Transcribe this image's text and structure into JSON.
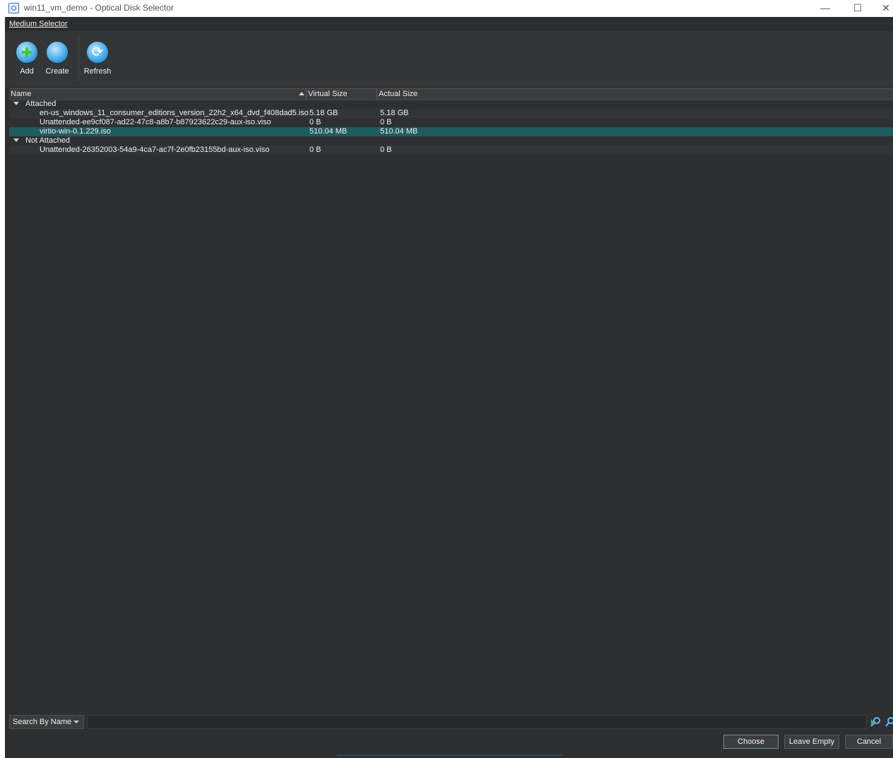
{
  "window": {
    "title": "win11_vm_demo - Optical Disk Selector",
    "minimize_glyph": "—",
    "maximize_glyph": "☐",
    "close_glyph": "✕"
  },
  "menu": {
    "medium_selector": "Medium Selector"
  },
  "toolbar": {
    "add_label": "Add",
    "create_label": "Create",
    "refresh_label": "Refresh",
    "refresh_glyph": "⟳"
  },
  "tree": {
    "columns": [
      "Name",
      "Virtual Size",
      "Actual Size"
    ],
    "groups": [
      {
        "label": "Attached",
        "items": [
          {
            "name": "en-us_windows_11_consumer_editions_version_22h2_x64_dvd_f408dad5.iso",
            "virtual_size": "5.18 GB",
            "actual_size": "5.18 GB"
          },
          {
            "name": "Unattended-ee9cf087-ad22-47c8-a8b7-b87923622c29-aux-iso.viso",
            "virtual_size": "0 B",
            "actual_size": "0 B"
          },
          {
            "name": "virtio-win-0.1.229.iso",
            "virtual_size": "510.04 MB",
            "actual_size": "510.04 MB",
            "selected": true
          }
        ]
      },
      {
        "label": "Not Attached",
        "items": [
          {
            "name": "Unattended-26352003-54a9-4ca7-ac7f-2e0fb23155bd-aux-iso.viso",
            "virtual_size": "0 B",
            "actual_size": "0 B"
          }
        ]
      }
    ]
  },
  "search": {
    "mode": "Search By Name",
    "value": ""
  },
  "buttons": {
    "choose": "Choose",
    "leave_empty": "Leave Empty",
    "cancel": "Cancel"
  },
  "colors": {
    "background": "#2d2f31",
    "selection": "#205b5e",
    "accent_icon": "#3fa6e6"
  }
}
